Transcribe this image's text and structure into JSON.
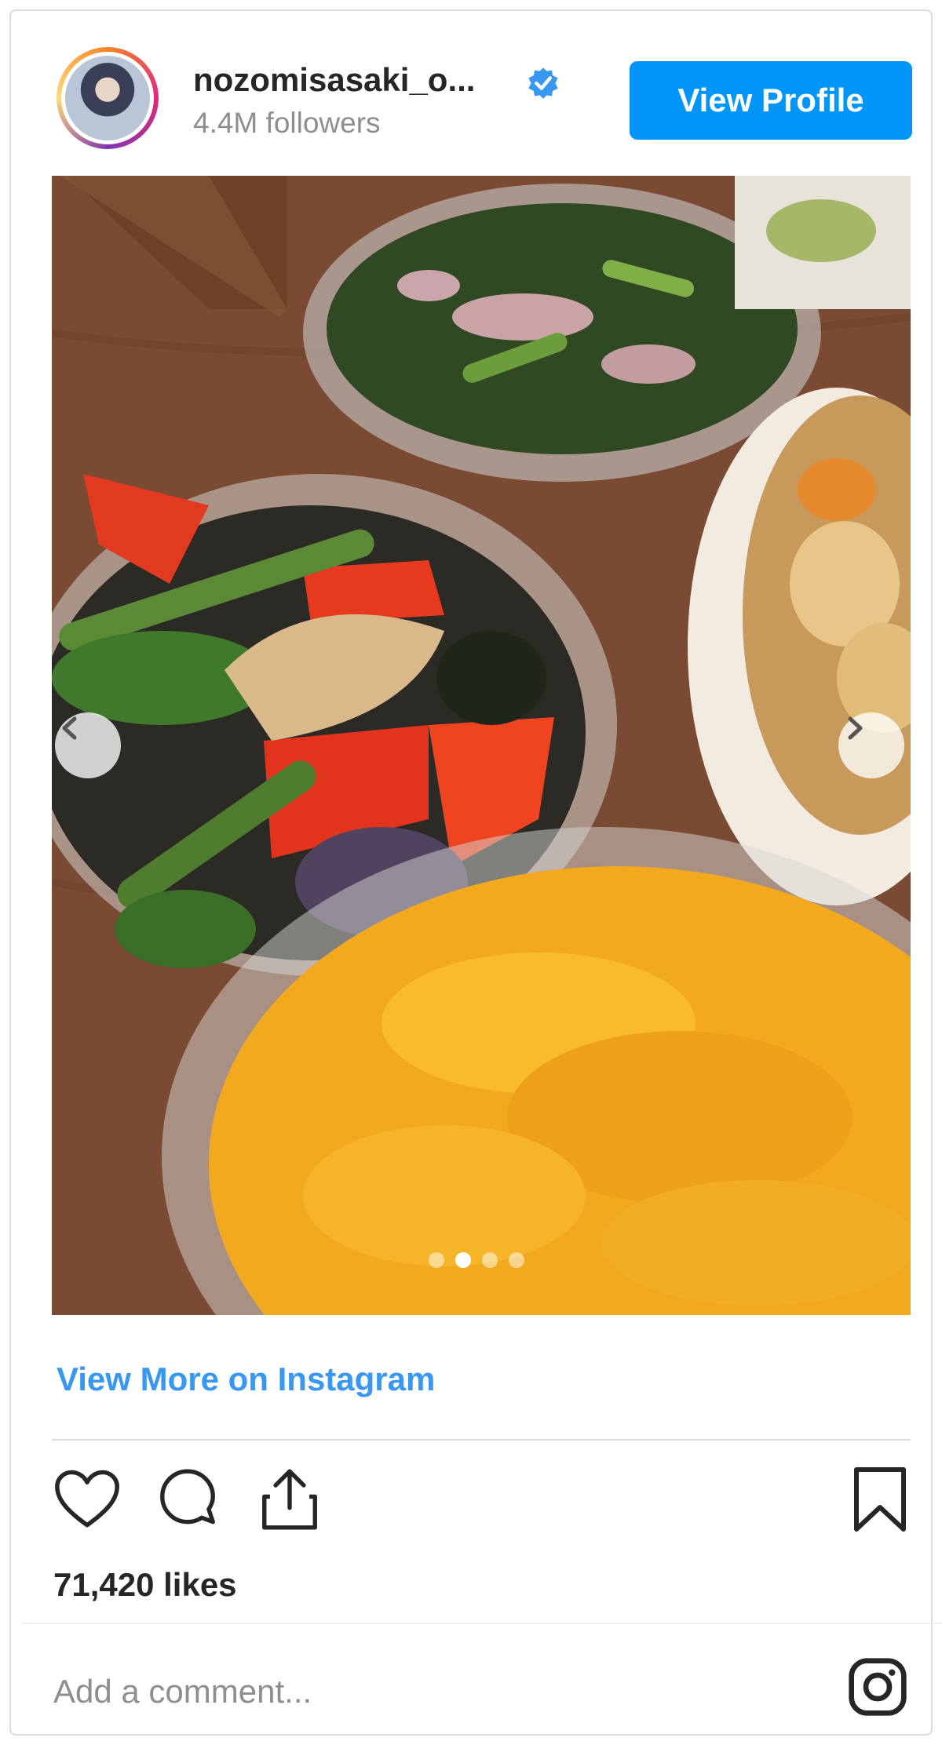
{
  "header": {
    "username": "nozomisasaki_o...",
    "followers": "4.4M followers",
    "view_profile_label": "View Profile"
  },
  "post": {
    "carousel": {
      "total_slides": 4,
      "active_slide": 2
    },
    "view_more_label": "View More on Instagram",
    "likes": "71,420 likes",
    "comment_placeholder": "Add a comment..."
  },
  "colors": {
    "accent": "#0095f6",
    "link": "#3897f0",
    "muted": "#8e8e8e",
    "border": "#dbdbdb"
  },
  "icons": {
    "verified": "verified-badge-icon",
    "like": "heart-icon",
    "comment": "comment-bubble-icon",
    "share": "share-icon",
    "save": "bookmark-icon",
    "prev": "chevron-left-icon",
    "next": "chevron-right-icon",
    "brand": "instagram-icon"
  }
}
